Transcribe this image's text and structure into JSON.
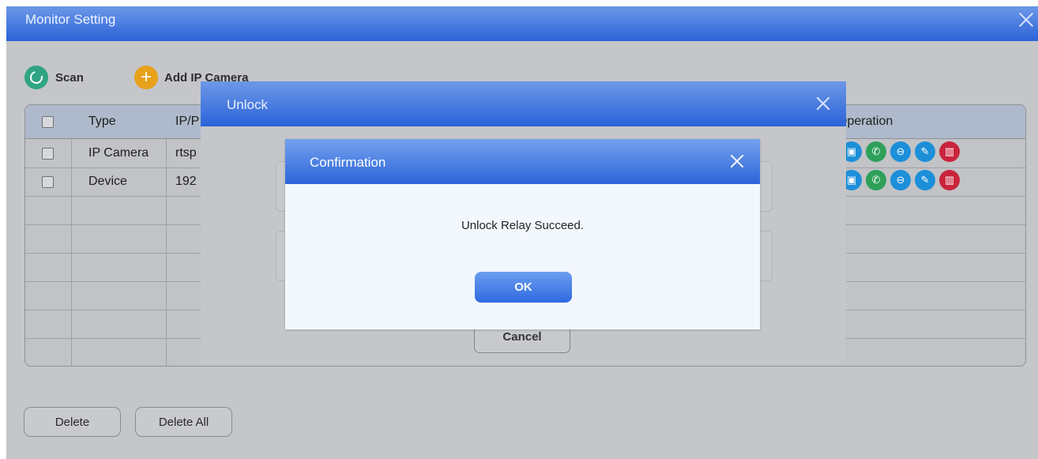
{
  "window": {
    "title": "Monitor Setting"
  },
  "toolbar": {
    "scan_label": "Scan",
    "add_label": "Add IP Camera"
  },
  "table": {
    "headers": {
      "type": "Type",
      "ip": "IP/P",
      "operation": "Operation"
    },
    "rows": [
      {
        "type": "IP Camera",
        "ip": "rtsp"
      },
      {
        "type": "Device",
        "ip": "192"
      }
    ],
    "operation_icons": [
      "monitor-icon",
      "call-icon",
      "unlock-icon",
      "edit-icon",
      "delete-icon"
    ]
  },
  "footer": {
    "delete_label": "Delete",
    "delete_all_label": "Delete All"
  },
  "unlock_dialog": {
    "title": "Unlock",
    "cancel_label": "Cancel"
  },
  "confirm_dialog": {
    "title": "Confirmation",
    "message": "Unlock Relay Succeed.",
    "ok_label": "OK"
  },
  "colors": {
    "title_bar": "#2b63d8",
    "scan": "#2fa584",
    "add": "#e7a11a",
    "op_blue": "#1d8fd9",
    "op_green": "#2ea05a",
    "op_red": "#c9243c"
  }
}
